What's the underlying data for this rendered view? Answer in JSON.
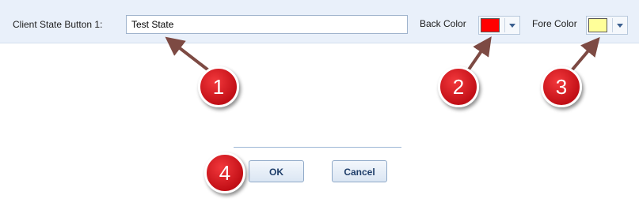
{
  "form": {
    "client_state_label": "Client State Button 1:",
    "client_state_value": "Test State",
    "back_color_label": "Back Color",
    "back_color_value": "#ff0000",
    "fore_color_label": "Fore Color",
    "fore_color_value": "#ffff99"
  },
  "buttons": {
    "ok_label": "OK",
    "cancel_label": "Cancel"
  },
  "callouts": {
    "one": "1",
    "two": "2",
    "three": "3",
    "four": "4",
    "color": "#d3141b"
  }
}
